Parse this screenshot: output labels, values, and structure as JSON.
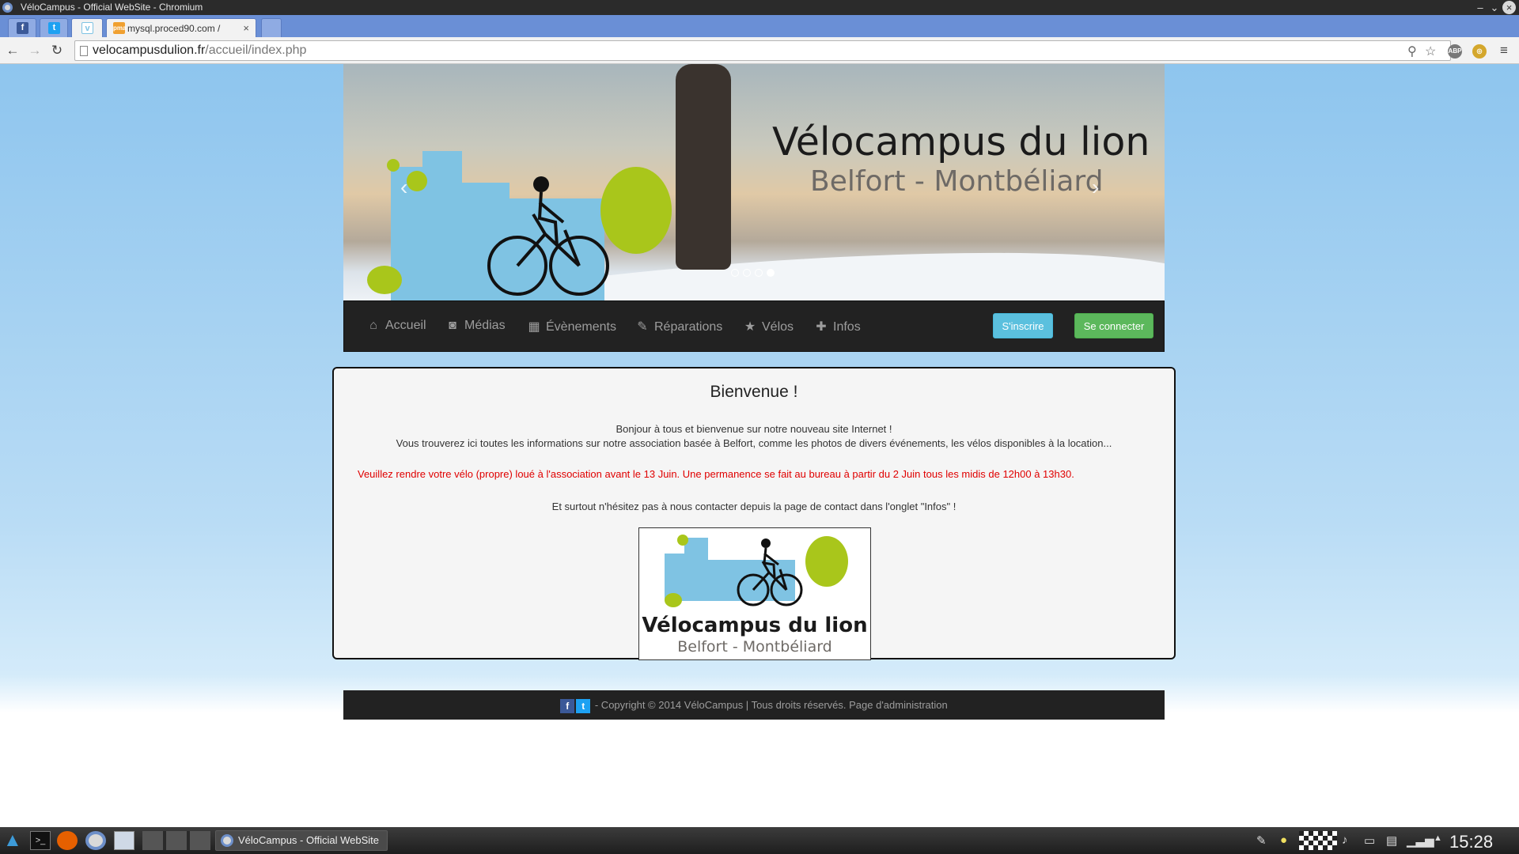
{
  "window": {
    "title": "VéloCampus - Official WebSite - Chromium"
  },
  "tabs": [
    {
      "label": "",
      "icon": "facebook-icon",
      "color": "#3b5998"
    },
    {
      "label": "",
      "icon": "twitter-icon",
      "color": "#1da1f2"
    },
    {
      "label": "",
      "icon": "velocampus-favicon",
      "color": "#ffffff",
      "active": true
    },
    {
      "label": "mysql.proced90.com /",
      "icon": "phpmyadmin-icon"
    }
  ],
  "tab_close": "×",
  "browser": {
    "url_host": "velocampusdulion.fr",
    "url_path": "/accueil/index.php"
  },
  "site": {
    "banner": {
      "title": "Vélocampus du lion",
      "subtitle": "Belfort - Montbéliard",
      "slides": 4,
      "active_slide": 4
    },
    "nav": [
      {
        "label": "Accueil",
        "icon": "home-icon",
        "glyph": "⌂"
      },
      {
        "label": "Médias",
        "icon": "camera-icon",
        "glyph": "◙"
      },
      {
        "label": "Évènements",
        "icon": "calendar-icon",
        "glyph": "▦"
      },
      {
        "label": "Réparations",
        "icon": "wrench-icon",
        "glyph": "✎"
      },
      {
        "label": "Vélos",
        "icon": "star-icon",
        "glyph": "★"
      },
      {
        "label": "Infos",
        "icon": "plus-icon",
        "glyph": "✚"
      }
    ],
    "signup_label": "S'inscrire",
    "login_label": "Se connecter",
    "content": {
      "title": "Bienvenue !",
      "line1": "Bonjour à tous et bienvenue sur notre nouveau site Internet !",
      "line2": "Vous trouverez ici toutes les informations sur notre association basée à Belfort, comme les photos de divers événements, les vélos disponibles à la location...",
      "warning": "Veuillez rendre votre vélo (propre) loué à l'association avant le 13 Juin. Une permanence se fait au bureau à partir du 2 Juin tous les midis de 12h00 à 13h30.",
      "line3": "Et surtout n'hésitez pas à nous contacter depuis la page de contact dans l'onglet \"Infos\" !",
      "logo_title": "Vélocampus du lion",
      "logo_subtitle": "Belfort - Montbéliard"
    },
    "footer": {
      "text": "- Copyright © 2014 VéloCampus | Tous droits réservés.",
      "admin_link": "Page d'administration"
    }
  },
  "taskbar": {
    "window_label": "VéloCampus - Official WebSite",
    "clock": "15:28"
  },
  "colors": {
    "navbar": "#222222",
    "signup": "#5bc0de",
    "login": "#5cb85c",
    "warning": "#e00000",
    "accent_green": "#a9c61b",
    "accent_blue": "#7fc3e3"
  }
}
